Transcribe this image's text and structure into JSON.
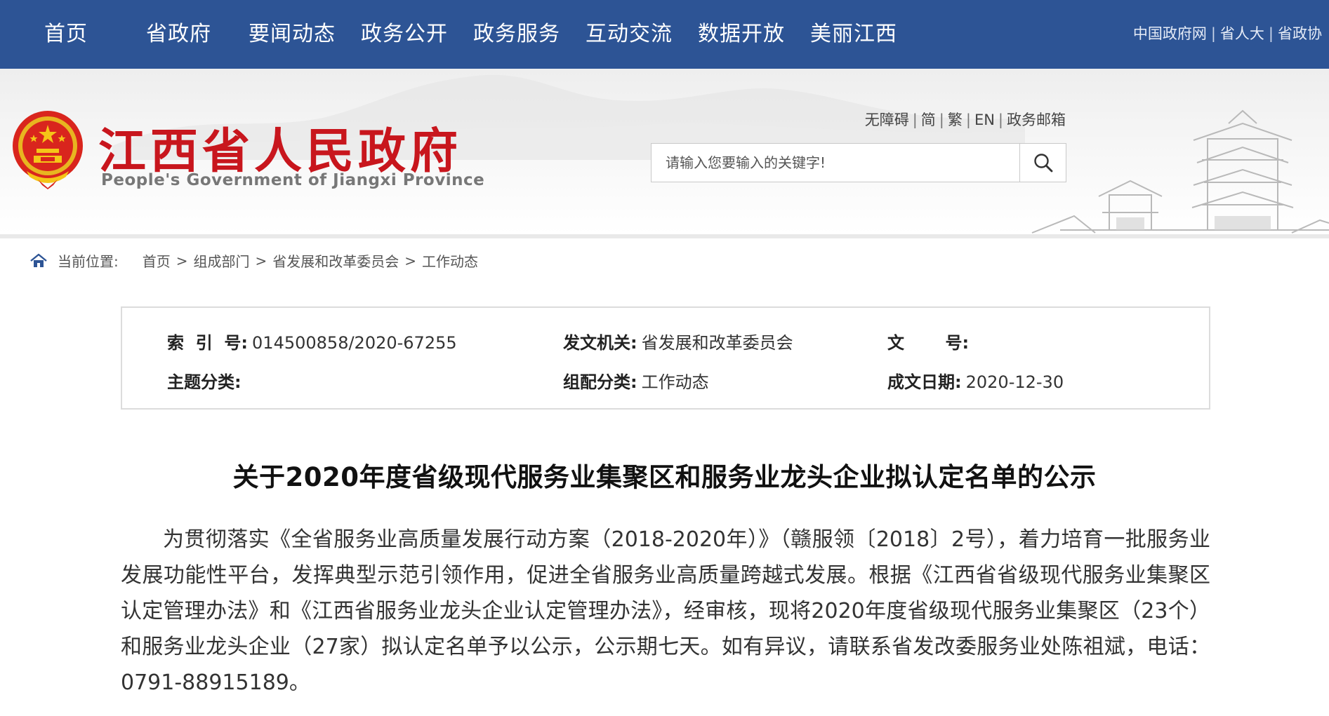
{
  "nav": {
    "items": [
      "首页",
      "省政府",
      "要闻动态",
      "政务公开",
      "政务服务",
      "互动交流",
      "数据开放",
      "美丽江西"
    ],
    "external_links": [
      "中国政府网",
      "省人大",
      "省政协"
    ]
  },
  "header": {
    "site_title": "江西省人民政府",
    "site_subtitle": "People's Government of Jiangxi Province",
    "tools": [
      "无障碍",
      "简",
      "繁",
      "EN",
      "政务邮箱"
    ],
    "search_placeholder": "请输入您要输入的关键字!"
  },
  "breadcrumb": {
    "label": "当前位置:",
    "items": [
      "首页",
      "组成部门",
      "省发展和改革委员会",
      "工作动态"
    ]
  },
  "info": {
    "index_label": "索  引  号:",
    "index_value": "014500858/2020-67255",
    "issuer_label": "发文机关:",
    "issuer_value": "省发展和改革委员会",
    "docno_label": "文       号:",
    "docno_value": "",
    "topic_label": "主题分类:",
    "topic_value": "",
    "category_label": "组配分类:",
    "category_value": "工作动态",
    "date_label": "成文日期:",
    "date_value": "2020-12-30"
  },
  "article": {
    "title": "关于2020年度省级现代服务业集聚区和服务业龙头企业拟认定名单的公示",
    "body": "为贯彻落实《全省服务业高质量发展行动方案（2018-2020年）》（赣服领〔2018〕2号），着力培育一批服务业发展功能性平台，发挥典型示范引领作用，促进全省服务业高质量跨越式发展。根据《江西省省级现代服务业集聚区认定管理办法》和《江西省服务业龙头企业认定管理办法》，经审核，现将2020年度省级现代服务业集聚区（23个）和服务业龙头企业（27家）拟认定名单予以公示，公示期七天。如有异议，请联系省发改委服务业处陈祖斌，电话：0791-88915189。"
  },
  "colors": {
    "nav_bg": "#2d5495",
    "title_red": "#c8161d"
  }
}
